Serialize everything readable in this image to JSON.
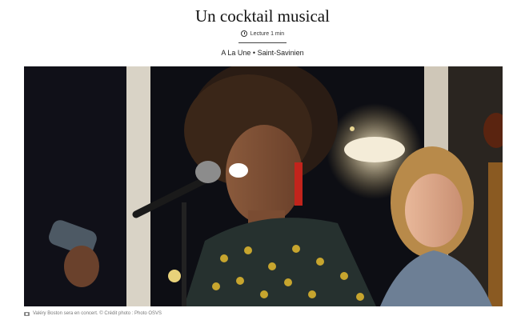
{
  "article": {
    "title": "Un cocktail musical",
    "read_time": "Lecture 1 min",
    "breadcrumb": {
      "section": "A La Une",
      "separator": "•",
      "city": "Saint-Savinien"
    }
  },
  "photo": {
    "caption": "Valéry Boston sera en concert. © Crédit photo : Photo OSVS",
    "icon": "camera-icon"
  }
}
